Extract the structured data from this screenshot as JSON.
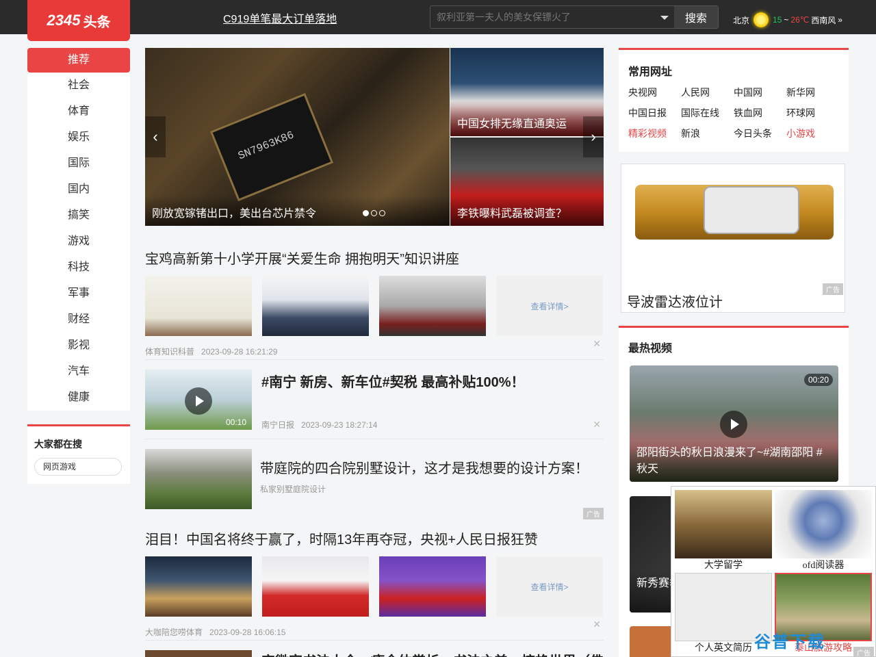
{
  "header": {
    "logo_main": "2345",
    "logo_sub": "头条",
    "headline": "C919单笔最大订单落地",
    "search_placeholder": "叙利亚第一夫人的美女保镖火了",
    "search_button": "搜索",
    "weather": {
      "city": "北京",
      "low": "15",
      "sep": "~",
      "high": "26℃",
      "wind": "西南风",
      "more": "»"
    }
  },
  "nav": {
    "items": [
      "推荐",
      "社会",
      "体育",
      "娱乐",
      "国际",
      "国内",
      "搞笑",
      "游戏",
      "科技",
      "军事",
      "财经",
      "影视",
      "汽车",
      "健康"
    ]
  },
  "hot_search": {
    "title": "大家都在搜",
    "item": "网页游戏"
  },
  "slider": {
    "main_caption": "刚放宽镓锗出口，美出台芯片禁令",
    "chip_text": "SN7963K86",
    "side1_caption": "中国女排无缘直通奥运",
    "side2_caption": "李铁曝料武磊被调查？",
    "prev": "‹",
    "next": "›"
  },
  "articles": [
    {
      "title": "宝鸡高新第十小学开展“关爱生命 拥抱明天”知识讲座",
      "more": "查看详情>",
      "source": "体育知识科普",
      "time": "2023-09-28 16:21:29"
    },
    {
      "title": "#南宁 新房、新车位#契税 最高补贴100%！",
      "duration": "00:10",
      "source": "南宁日报",
      "time": "2023-09-23 18:27:14"
    },
    {
      "title": "带庭院的四合院别墅设计，这才是我想要的设计方案！",
      "source": "私家别墅庭院设计",
      "ad": "广告"
    },
    {
      "title": "泪目！中国名将终于赢了，时隔13年再夺冠，央视+人民日报狂赞",
      "more": "查看详情>",
      "source": "大咖陪您唠体育",
      "time": "2023-09-28 16:06:15"
    },
    {
      "title": "宋徽宗书法大全：瘦金体赏析，书法之美，惊艳世界（佛"
    }
  ],
  "sites": {
    "title": "常用网址",
    "links": [
      "央视网",
      "人民网",
      "中国网",
      "新华网",
      "中国日报",
      "国际在线",
      "铁血网",
      "环球网",
      "精彩视频",
      "新浪",
      "今日头条",
      "小游戏"
    ]
  },
  "ad": {
    "title": "导波雷达液位计",
    "tag": "广告"
  },
  "hot_videos": {
    "title": "最热视频",
    "v1_caption": "邵阳街头的秋日浪漫来了~#湖南邵阳 #秋天",
    "v1_duration": "00:20",
    "v2_caption": "新秀赛季战WNBA"
  },
  "popup": {
    "tiles": [
      "大学留学",
      "ofd阅读器",
      "个人英文简历",
      "泰山旅游攻略"
    ],
    "ad_tag": "广告"
  },
  "watermark": "谷普下载",
  "colors": {
    "accent": "#e94545",
    "topbar": "#2b2b2b"
  }
}
